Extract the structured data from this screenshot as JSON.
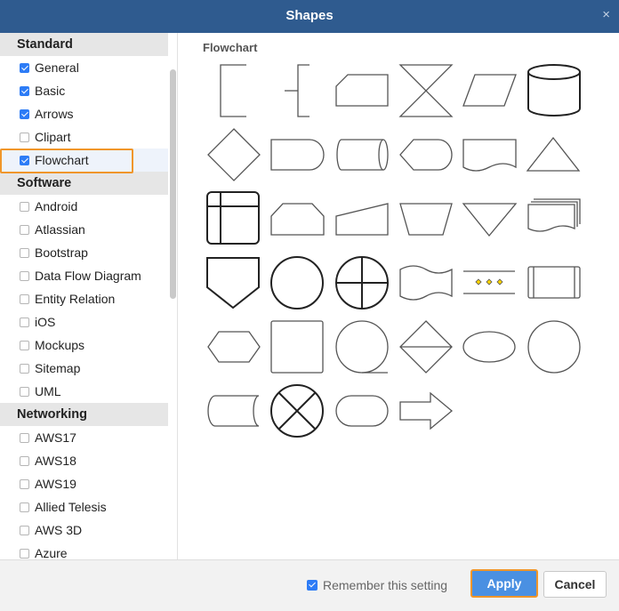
{
  "dialog": {
    "title": "Shapes",
    "close_glyph": "×"
  },
  "sidebar": {
    "groups": [
      {
        "label": "Standard",
        "items": [
          {
            "label": "General",
            "checked": true
          },
          {
            "label": "Basic",
            "checked": true
          },
          {
            "label": "Arrows",
            "checked": true
          },
          {
            "label": "Clipart",
            "checked": false
          },
          {
            "label": "Flowchart",
            "checked": true,
            "highlighted": true
          }
        ]
      },
      {
        "label": "Software",
        "items": [
          {
            "label": "Android",
            "checked": false
          },
          {
            "label": "Atlassian",
            "checked": false
          },
          {
            "label": "Bootstrap",
            "checked": false
          },
          {
            "label": "Data Flow Diagram",
            "checked": false
          },
          {
            "label": "Entity Relation",
            "checked": false
          },
          {
            "label": "iOS",
            "checked": false
          },
          {
            "label": "Mockups",
            "checked": false
          },
          {
            "label": "Sitemap",
            "checked": false
          },
          {
            "label": "UML",
            "checked": false
          }
        ]
      },
      {
        "label": "Networking",
        "items": [
          {
            "label": "AWS17",
            "checked": false
          },
          {
            "label": "AWS18",
            "checked": false
          },
          {
            "label": "AWS19",
            "checked": false
          },
          {
            "label": "Allied Telesis",
            "checked": false
          },
          {
            "label": "AWS 3D",
            "checked": false
          },
          {
            "label": "Azure",
            "checked": false
          }
        ]
      }
    ]
  },
  "main": {
    "heading": "Flowchart",
    "shapes": [
      "annotation-1",
      "annotation-2",
      "card",
      "collate",
      "data",
      "database",
      "decision",
      "delay",
      "direct-data",
      "display",
      "document",
      "extract",
      "internal-storage",
      "loop-limit",
      "manual-input",
      "manual-operation",
      "merge",
      "multi-document",
      "off-page-reference",
      "on-page-reference",
      "or",
      "paper-tape",
      "parallel-mode",
      "predefined-process",
      "preparation",
      "process",
      "sequential-data",
      "sort",
      "start-1",
      "start-2",
      "stored-data",
      "summing-function",
      "terminator",
      "transfer"
    ]
  },
  "footer": {
    "remember_label": "Remember this setting",
    "remember_checked": true,
    "apply_label": "Apply",
    "cancel_label": "Cancel"
  },
  "colors": {
    "titlebar": "#2f5b8f",
    "accent": "#4a90e2",
    "highlight_border": "#f0962a",
    "checkbox": "#2d7cf6"
  }
}
